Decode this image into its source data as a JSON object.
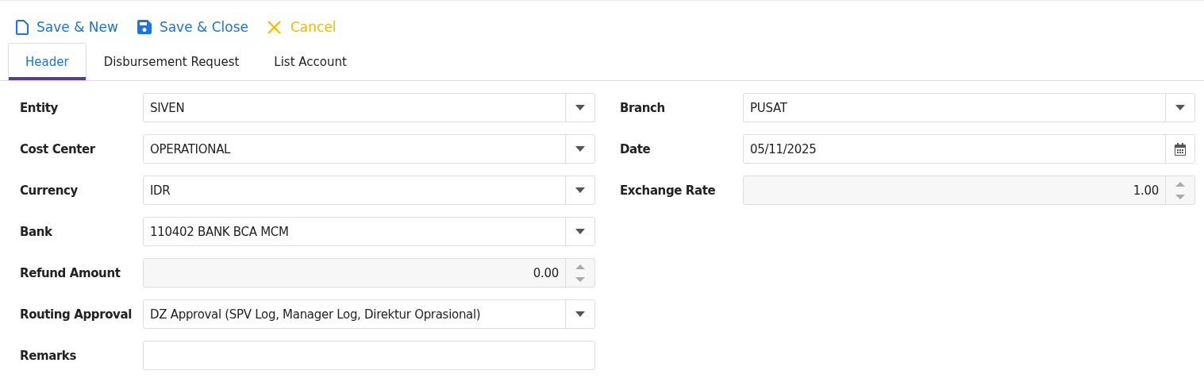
{
  "toolbar": [
    {
      "label": "Save & New",
      "kind": "new"
    },
    {
      "label": "Save & Close",
      "kind": "save"
    },
    {
      "label": "Cancel",
      "kind": "cancel"
    }
  ],
  "tabs": [
    {
      "label": "Header",
      "selected": true
    },
    {
      "label": "Disbursement Request",
      "selected": false
    },
    {
      "label": "List Account",
      "selected": false
    }
  ],
  "left_fields": [
    {
      "label": "Entity",
      "value": "SIVEN",
      "kind": "dropdown"
    },
    {
      "label": "Cost Center",
      "value": "OPERATIONAL",
      "kind": "dropdown"
    },
    {
      "label": "Currency",
      "value": "IDR",
      "kind": "dropdown"
    },
    {
      "label": "Bank",
      "value": "110402 BANK BCA MCM",
      "kind": "dropdown"
    },
    {
      "label": "Refund Amount",
      "value": "0.00",
      "kind": "number"
    },
    {
      "label": "Routing Approval",
      "value": "DZ Approval (SPV Log, Manager Log, Direktur Oprasional)",
      "kind": "dropdown"
    },
    {
      "label": "Remarks",
      "kind": "text"
    }
  ],
  "right_fields": [
    {
      "label": "Branch",
      "value": "PUSAT",
      "kind": "dropdown"
    },
    {
      "label": "Date",
      "value": "05/11/2025",
      "kind": "date"
    },
    {
      "label": "Exchange Rate",
      "value": "1.00",
      "kind": "number"
    }
  ]
}
